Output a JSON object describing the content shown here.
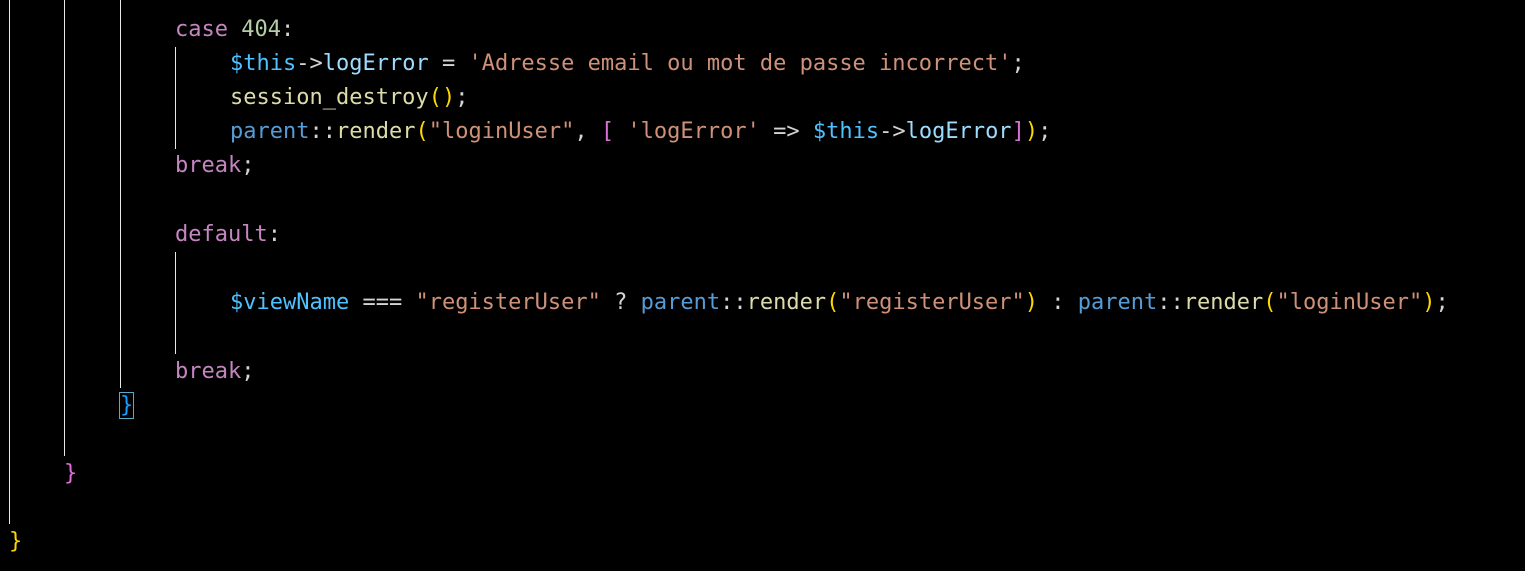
{
  "editor": {
    "background": "#000000",
    "lines": {
      "case404": {
        "keyword": "case",
        "value": "404",
        "colon": ":"
      },
      "logError_assign": {
        "var": "$this",
        "arrow": "->",
        "prop": "logError",
        "eq": " = ",
        "str": "'Adresse email ou mot de passe incorrect'",
        "semi": ";"
      },
      "session_destroy": {
        "fn": "session_destroy",
        "open": "(",
        "close": ")",
        "semi": ";"
      },
      "render_login": {
        "scope": "parent",
        "dcolon": "::",
        "fn": "render",
        "open": "(",
        "arg1": "\"loginUser\"",
        "comma": ", ",
        "bopen": "[",
        "space": " ",
        "key": "'logError'",
        "fat": " => ",
        "var": "$this",
        "arrow": "->",
        "prop": "logError",
        "bclose": "]",
        "close": ")",
        "semi": ";"
      },
      "break1": {
        "keyword": "break",
        "semi": ";"
      },
      "default": {
        "keyword": "default",
        "colon": ":"
      },
      "ternary": {
        "var": "$viewName",
        "eq": " === ",
        "str1": "\"registerUser\"",
        "q": " ? ",
        "scope1": "parent",
        "dc1": "::",
        "fn1": "render",
        "o1": "(",
        "arg1": "\"registerUser\"",
        "c1": ")",
        "colon": " : ",
        "scope2": "parent",
        "dc2": "::",
        "fn2": "render",
        "o2": "(",
        "arg2": "\"loginUser\"",
        "c2": ")",
        "semi": ";"
      },
      "break2": {
        "keyword": "break",
        "semi": ";"
      },
      "close_switch": "}",
      "close_method": "}",
      "close_class": "}"
    }
  }
}
